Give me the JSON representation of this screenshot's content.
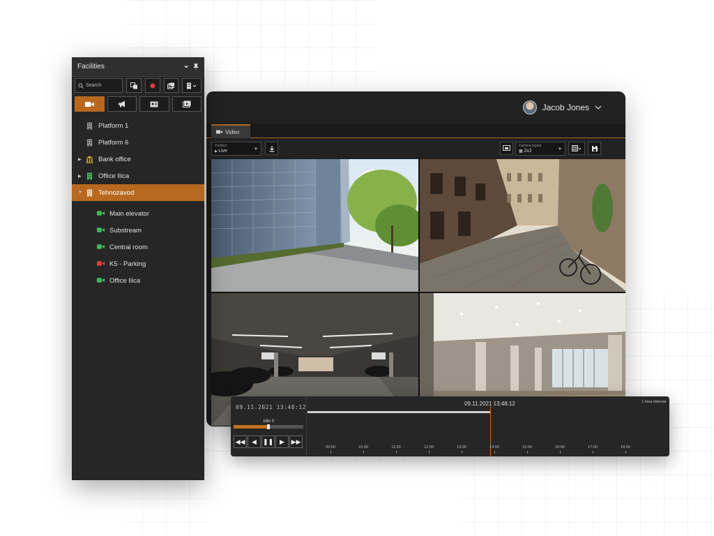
{
  "facilities_panel": {
    "title": "Facilities",
    "search_placeholder": "Search",
    "tree": [
      {
        "label": "Platform 1",
        "type": "building",
        "level": 1
      },
      {
        "label": "Platform 6",
        "type": "building",
        "level": 1
      },
      {
        "label": "Bank office",
        "type": "bank",
        "level": 1,
        "expandable": true
      },
      {
        "label": "Office Ilica",
        "type": "building-green",
        "level": 1,
        "expandable": true
      },
      {
        "label": "Tehnozavod",
        "type": "building",
        "level": 1,
        "expanded": true,
        "selected": true
      },
      {
        "label": "Main elevator",
        "type": "camera-green",
        "level": 2
      },
      {
        "label": "Substream",
        "type": "camera-green",
        "level": 2
      },
      {
        "label": "Central room",
        "type": "camera-green",
        "level": 2
      },
      {
        "label": "K5 - Parking",
        "type": "camera-red",
        "level": 2
      },
      {
        "label": "Office Ilica",
        "type": "camera-green",
        "level": 2
      }
    ]
  },
  "header": {
    "user_name": "Jacob Jones"
  },
  "tabs": {
    "video_label": "Video"
  },
  "toolbar": {
    "position_label": "Position",
    "position_value": "Live",
    "layout_label": "Camera layout",
    "layout_value": "2x2"
  },
  "timeline": {
    "left_time": "09.11.2021  13:48:12",
    "center_time": "09.11.2021 13:48:12",
    "idle_label": "Idle 0",
    "interval_label": "1 hour interval",
    "progress": 0.5,
    "hours": [
      "09:00",
      "10:00",
      "11:00",
      "12:00",
      "13:00",
      "14:00",
      "15:00",
      "16:00",
      "17:00",
      "18:00"
    ]
  },
  "colors": {
    "accent": "#b8691f",
    "camera_ok": "#3dbb5a",
    "camera_alarm": "#e0403a"
  }
}
